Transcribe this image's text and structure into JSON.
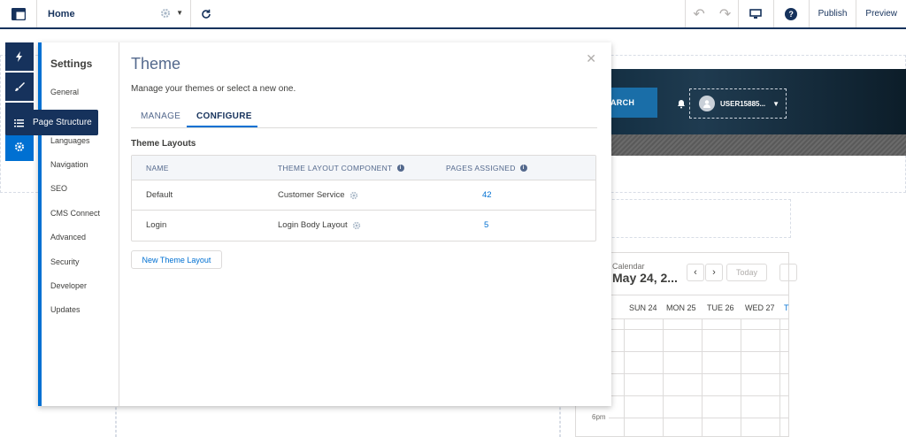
{
  "topbar": {
    "page_name": "Home",
    "publish_label": "Publish",
    "preview_label": "Preview"
  },
  "rail": {
    "tooltip_label": "Page Structure"
  },
  "settings": {
    "title": "Settings",
    "items": [
      {
        "label": "General"
      },
      {
        "label": "Languages"
      },
      {
        "label": "Navigation"
      },
      {
        "label": "SEO"
      },
      {
        "label": "CMS Connect"
      },
      {
        "label": "Advanced"
      },
      {
        "label": "Security"
      },
      {
        "label": "Developer"
      },
      {
        "label": "Updates"
      }
    ]
  },
  "theme": {
    "title": "Theme",
    "subtitle": "Manage your themes or select a new one.",
    "tabs": [
      {
        "label": "MANAGE"
      },
      {
        "label": "CONFIGURE",
        "active": true
      }
    ],
    "section_title": "Theme Layouts",
    "columns": [
      "NAME",
      "THEME LAYOUT COMPONENT",
      "PAGES ASSIGNED"
    ],
    "rows": [
      {
        "name": "Default",
        "component": "Customer Service",
        "pages": "42"
      },
      {
        "name": "Login",
        "component": "Login Body Layout",
        "pages": "5"
      }
    ],
    "new_button": "New Theme Layout"
  },
  "background": {
    "search_label": "ARCH",
    "user_label": "USER15885...",
    "calendar_label": "Calendar",
    "calendar_date": "May 24, 2...",
    "today_label": "Today",
    "days": [
      "SUN 24",
      "MON 25",
      "TUE 26",
      "WED 27",
      "T"
    ],
    "time_label": "6pm"
  },
  "colors": {
    "brand_navy": "#16325c",
    "accent_blue": "#0070d2"
  }
}
